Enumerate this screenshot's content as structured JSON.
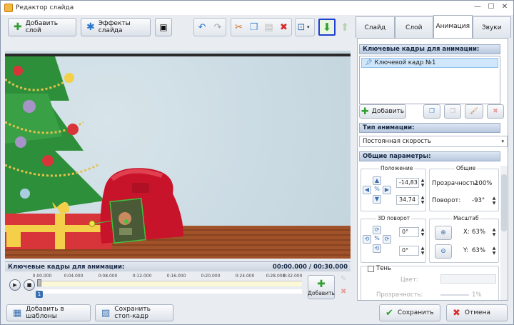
{
  "window": {
    "title": "Редактор слайда",
    "minimize": "—",
    "maximize": "☐",
    "close": "✕"
  },
  "toolbar": {
    "add_layer": "Добавить слой",
    "slide_effects": "Эффекты слайда"
  },
  "canvas_labels": {
    "keyframes_title": "Ключевые кадры для анимации:",
    "time_readout": "00:00.000 / 00:30.000"
  },
  "timeline": {
    "ticks": [
      "0.00.000",
      "0:04.000",
      "0:08.000",
      "0:12.000",
      "0:16.000",
      "0:20.000",
      "0:24.000",
      "0:28.000",
      "0:32.000"
    ],
    "marker": "1",
    "add_label": "Добавить"
  },
  "tabs": [
    {
      "label": "Слайд"
    },
    {
      "label": "Слой"
    },
    {
      "label": "Анимация"
    },
    {
      "label": "Звуки"
    }
  ],
  "animation": {
    "keyframes_header": "Ключевые кадры для анимации:",
    "keyframe_item": "Ключевой кадр №1",
    "add_button": "Добавить",
    "type_header": "Тип анимации:",
    "type_value": "Постоянная скорость",
    "common_header": "Общие параметры:",
    "position_title": "Положение",
    "position_x": "-14,83",
    "position_y": "34,74",
    "general_title": "Общие",
    "opacity_label": "Прозрачность:",
    "opacity_value": "100%",
    "rotation_label": "Поворот:",
    "rotation_value": "-93°",
    "rotate3d_title": "3D поворот",
    "rotate3d_a": "0°",
    "rotate3d_b": "0°",
    "scale_title": "Масштаб",
    "scale_x_label": "X:",
    "scale_x_value": "63%",
    "scale_y_label": "Y:",
    "scale_y_value": "63%",
    "shadow_label": "Тень",
    "shadow_color_label": "Цвет:",
    "shadow_opacity_label": "Прозрачность:",
    "shadow_opacity_value": "1%"
  },
  "bottom": {
    "add_to_templates": "Добавить в шаблоны",
    "save_stop_frame": "Сохранить стоп-кадр",
    "save": "Сохранить",
    "cancel": "Отмена"
  },
  "colors": {
    "accent": "#1e3fd0",
    "green": "#2f9e2f",
    "red": "#d82b2b"
  }
}
